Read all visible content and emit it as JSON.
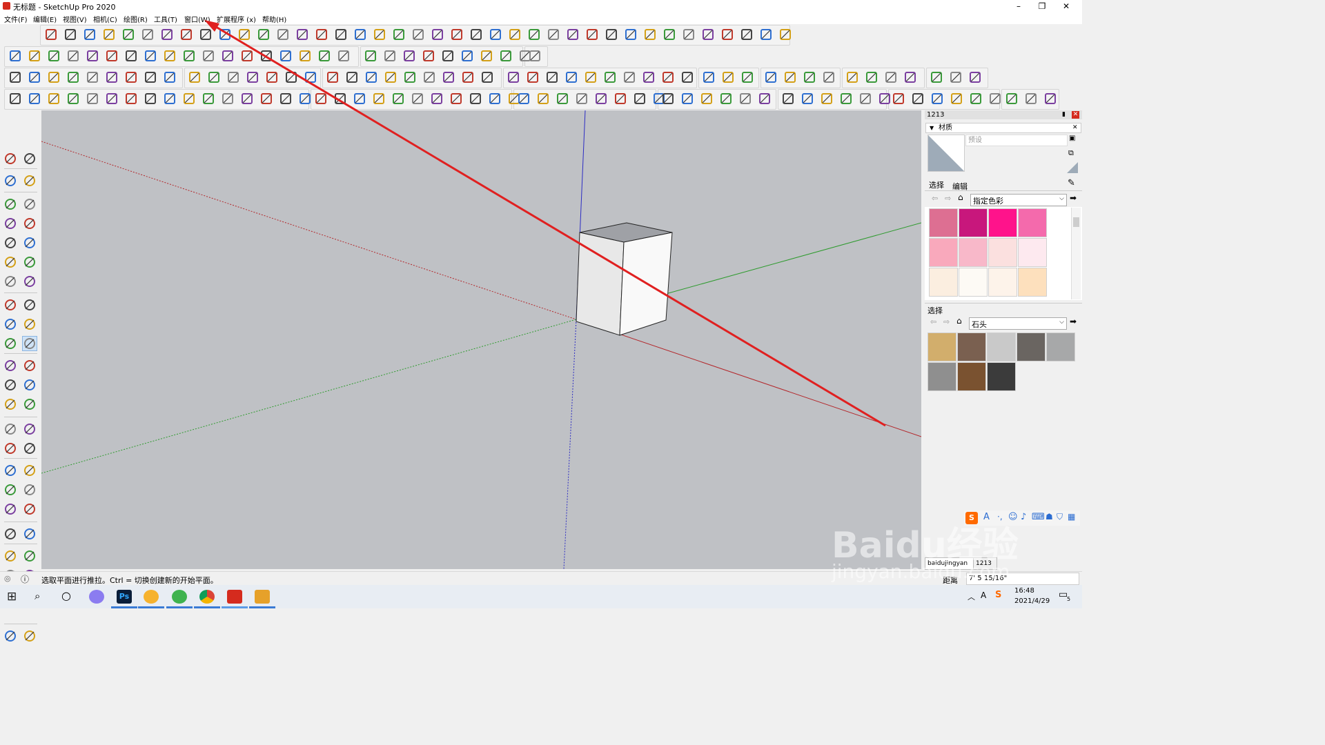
{
  "window": {
    "title": "无标题 - SketchUp Pro 2020",
    "minimize": "–",
    "maximize": "❐",
    "close": "✕"
  },
  "menu": [
    "文件(F)",
    "编辑(E)",
    "视图(V)",
    "相机(C)",
    "绘图(R)",
    "工具(T)",
    "窗口(W)",
    "扩展程序 (x)",
    "帮助(H)"
  ],
  "tray": {
    "panel_title": "1213",
    "materials": {
      "header": "材质",
      "preset_name": "预设",
      "tab_select": "选择",
      "tab_edit": "编辑",
      "library": "指定色彩",
      "secondary_label": "选择",
      "secondary_library": "石头",
      "swatch_colors": [
        "#dd6f92",
        "#c8177c",
        "#ff138b",
        "#f46aac",
        "#f9a9bc",
        "#f8b8c9",
        "#fbe0df",
        "#fde9ef",
        "#fbeee0",
        "#fdfaf5",
        "#fdf3ea",
        "#fde0bd"
      ],
      "stone_colors": [
        "#d2ae6c",
        "#7a6050",
        "#c9c9c9",
        "#6a6561",
        "#a7a8a9",
        "#8f8f8f",
        "#7a5230",
        "#3b3b3b"
      ]
    },
    "bottom_tabs": [
      "baidujingyan",
      "1213"
    ]
  },
  "status": {
    "hint": "选取平面进行推拉。Ctrl = 切换创建新的开始平面。",
    "measure_label": "距离",
    "measure_value": "7' 5 15/16\""
  },
  "taskbar": {
    "time": "16:48",
    "date": "2021/4/29",
    "notifications": "5"
  },
  "watermark": {
    "line1": "Baidu经验",
    "line2": "jingyan.baidu.com"
  },
  "colors": {
    "viewport_bg": "#bfc1c5",
    "axis_red": "#b3262a",
    "axis_green": "#2e9b2e",
    "axis_blue": "#2b2bc4",
    "annotation_arrow": "#e02020"
  }
}
